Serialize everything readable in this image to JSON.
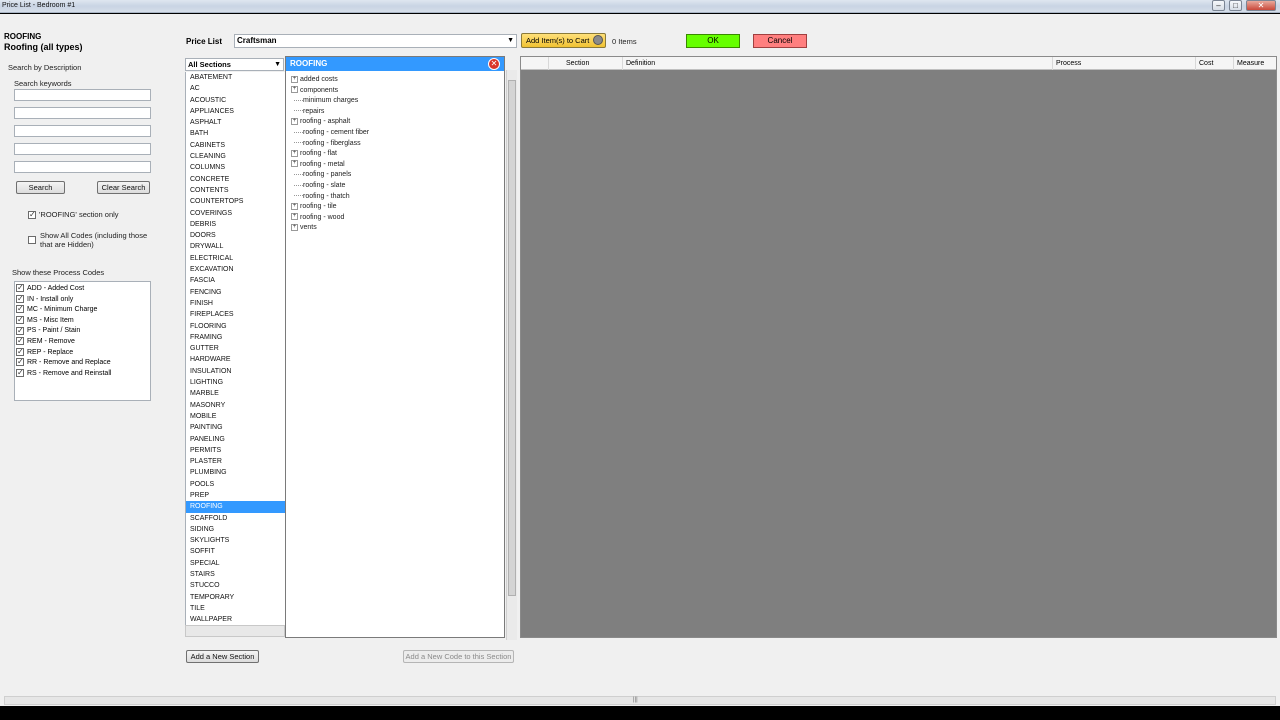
{
  "window": {
    "title": "Price List - Bedroom #1"
  },
  "header": {
    "section": "ROOFING",
    "subtitle": "Roofing (all types)"
  },
  "search": {
    "group_label": "Search by Description",
    "keywords_label": "Search keywords",
    "search_button": "Search",
    "clear_button": "Clear Search",
    "section_only": "'ROOFING' section only",
    "show_all_codes": "Show All Codes (including those that are Hidden)"
  },
  "process_codes": {
    "label": "Show these Process Codes",
    "items": [
      {
        "label": "ADD - Added Cost",
        "checked": true
      },
      {
        "label": "IN - Install only",
        "checked": true
      },
      {
        "label": "MC - Minimum Charge",
        "checked": true
      },
      {
        "label": "MS - Misc Item",
        "checked": true
      },
      {
        "label": "PS - Paint / Stain",
        "checked": true
      },
      {
        "label": "REM - Remove",
        "checked": true
      },
      {
        "label": "REP - Replace",
        "checked": true
      },
      {
        "label": "RR - Remove and Replace",
        "checked": true
      },
      {
        "label": "RS - Remove and Reinstall",
        "checked": true
      }
    ]
  },
  "pricelist": {
    "label": "Price List",
    "value": "Craftsman"
  },
  "cart": {
    "add_button": "Add Item(s) to Cart",
    "count": "0 Items"
  },
  "actions": {
    "ok": "OK",
    "cancel": "Cancel",
    "ok_color": "#66ff00",
    "cancel_color": "#ff7f7f"
  },
  "sections": {
    "dropdown": "All Sections",
    "selected": "ROOFING",
    "items": [
      "ABATEMENT",
      "AC",
      "ACOUSTIC",
      "APPLIANCES",
      "ASPHALT",
      "BATH",
      "CABINETS",
      "CLEANING",
      "COLUMNS",
      "CONCRETE",
      "CONTENTS",
      "COUNTERTOPS",
      "COVERINGS",
      "DEBRIS",
      "DOORS",
      "DRYWALL",
      "ELECTRICAL",
      "EXCAVATION",
      "FASCIA",
      "FENCING",
      "FINISH",
      "FIREPLACES",
      "FLOORING",
      "FRAMING",
      "GUTTER",
      "HARDWARE",
      "INSULATION",
      "LIGHTING",
      "MARBLE",
      "MASONRY",
      "MOBILE",
      "PAINTING",
      "PANELING",
      "PERMITS",
      "PLASTER",
      "PLUMBING",
      "POOLS",
      "PREP",
      "ROOFING",
      "SCAFFOLD",
      "SIDING",
      "SKYLIGHTS",
      "SOFFIT",
      "SPECIAL",
      "STAIRS",
      "STUCCO",
      "TEMPORARY",
      "TILE",
      "WALLPAPER"
    ]
  },
  "tree": {
    "title": "ROOFING",
    "nodes": [
      {
        "label": "added costs",
        "expandable": true
      },
      {
        "label": "components",
        "expandable": true
      },
      {
        "label": "minimum charges",
        "expandable": false
      },
      {
        "label": "repairs",
        "expandable": false
      },
      {
        "label": "roofing - asphalt",
        "expandable": true
      },
      {
        "label": "roofing - cement fiber",
        "expandable": false
      },
      {
        "label": "roofing - fiberglass",
        "expandable": false
      },
      {
        "label": "roofing - flat",
        "expandable": true
      },
      {
        "label": "roofing - metal",
        "expandable": true
      },
      {
        "label": "roofing - panels",
        "expandable": false
      },
      {
        "label": "roofing - slate",
        "expandable": false
      },
      {
        "label": "roofing - thatch",
        "expandable": false
      },
      {
        "label": "roofing - tile",
        "expandable": true
      },
      {
        "label": "roofing - wood",
        "expandable": true
      },
      {
        "label": "vents",
        "expandable": true
      }
    ]
  },
  "grid": {
    "columns": [
      "Section",
      "Definition",
      "Process",
      "Cost",
      "Measure"
    ]
  },
  "bottom": {
    "add_section": "Add a New Section",
    "add_code": "Add a New Code to this Section"
  }
}
